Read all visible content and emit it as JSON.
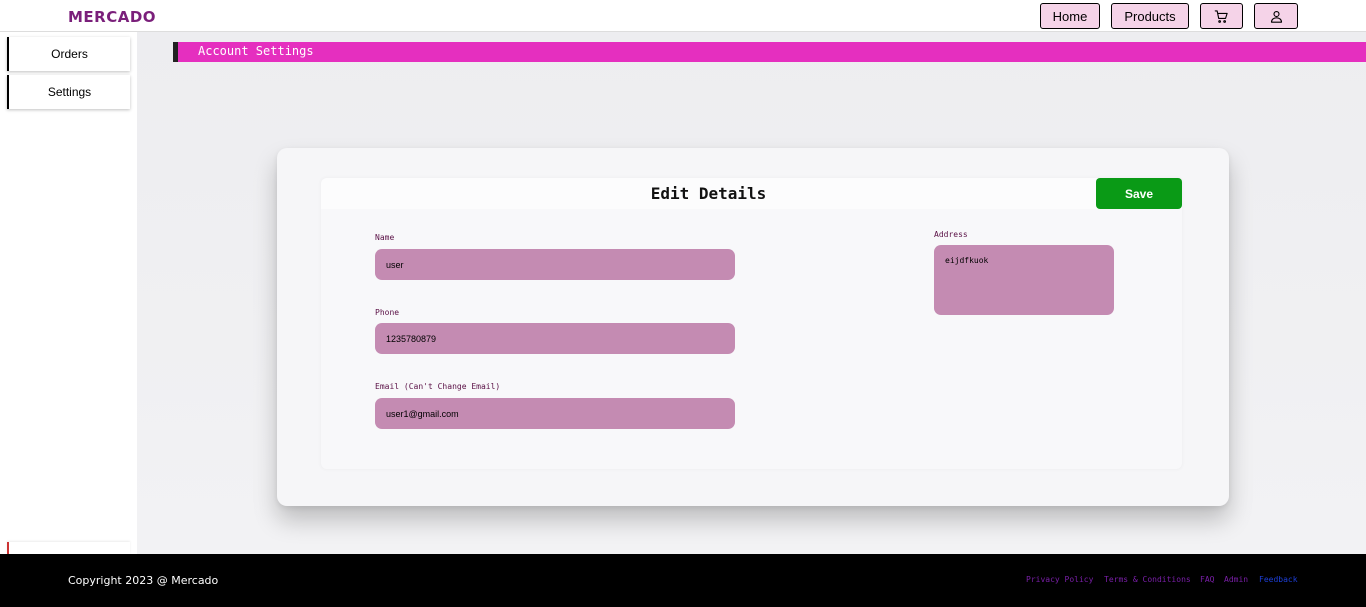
{
  "app": {
    "logo": "MERCADO"
  },
  "header": {
    "nav": {
      "home": "Home",
      "products": "Products"
    },
    "icons": {
      "cart": "cart-icon",
      "user": "user-icon"
    }
  },
  "sidebar": {
    "items": [
      {
        "label": "Orders"
      },
      {
        "label": "Settings"
      }
    ]
  },
  "section": {
    "title": "Account Settings",
    "accent_color": "#e52fbf"
  },
  "form": {
    "title": "Edit Details",
    "save_label": "Save",
    "save_color": "#0a9a16",
    "name": {
      "label": "Name",
      "value": "user"
    },
    "phone": {
      "label": "Phone",
      "value": "1235780879"
    },
    "email": {
      "label": "Email (Can't Change Email)",
      "value": "user1@gmail.com"
    },
    "address": {
      "label": "Address",
      "value": "eijdfkuok"
    },
    "input_color": "#c48bb2"
  },
  "footer": {
    "copyright": "Copyright 2023 @ Mercado",
    "links": {
      "privacy": "Privacy Policy",
      "terms": "Terms & Conditions",
      "faq": "FAQ",
      "admin": "Admin",
      "feedback": "Feedback"
    }
  }
}
